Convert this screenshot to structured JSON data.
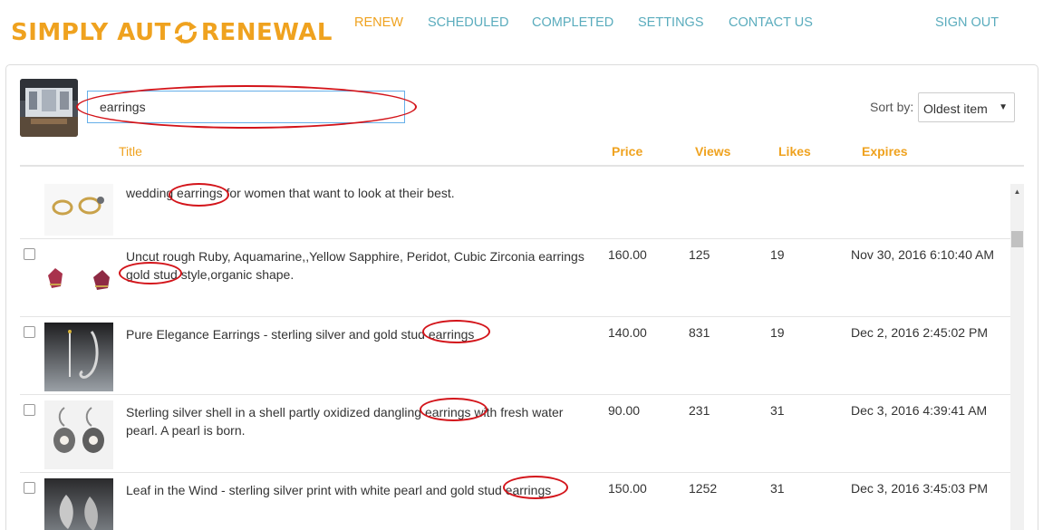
{
  "brand": {
    "part1": "SIMPLY AUT",
    "part2": " RENEWAL",
    "color": "#efa21f"
  },
  "nav": {
    "renew": "RENEW",
    "scheduled": "SCHEDULED",
    "completed": "COMPLETED",
    "settings": "SETTINGS",
    "contact": "CONTACT US",
    "signout": "SIGN OUT",
    "active_color": "#efa21f",
    "link_color": "#5aacbd"
  },
  "search": {
    "value": "earrings"
  },
  "sort": {
    "label": "Sort by:",
    "selected": "Oldest item"
  },
  "columns": {
    "title": "Title",
    "price": "Price",
    "views": "Views",
    "likes": "Likes",
    "expires": "Expires"
  },
  "items": [
    {
      "title": "wedding earrings for women that want to look at their best.",
      "price": "",
      "views": "",
      "likes": "",
      "expires": ""
    },
    {
      "title": "Uncut rough Ruby, Aquamarine,,Yellow Sapphire, Peridot, Cubic Zirconia earrings gold stud style,organic shape.",
      "price": "160.00",
      "views": "125",
      "likes": "19",
      "expires": "Nov 30, 2016 6:10:40 AM"
    },
    {
      "title": "Pure Elegance Earrings - sterling silver and gold stud earrings",
      "price": "140.00",
      "views": "831",
      "likes": "19",
      "expires": "Dec 2, 2016 2:45:02 PM"
    },
    {
      "title": "Sterling silver shell in a shell partly oxidized dangling earrings with fresh water pearl. A pearl is born.",
      "price": "90.00",
      "views": "231",
      "likes": "31",
      "expires": "Dec 3, 2016 4:39:41 AM"
    },
    {
      "title": "Leaf in the Wind - sterling silver print with white pearl and gold stud earrings",
      "price": "150.00",
      "views": "1252",
      "likes": "31",
      "expires": "Dec 3, 2016 3:45:03 PM"
    }
  ]
}
